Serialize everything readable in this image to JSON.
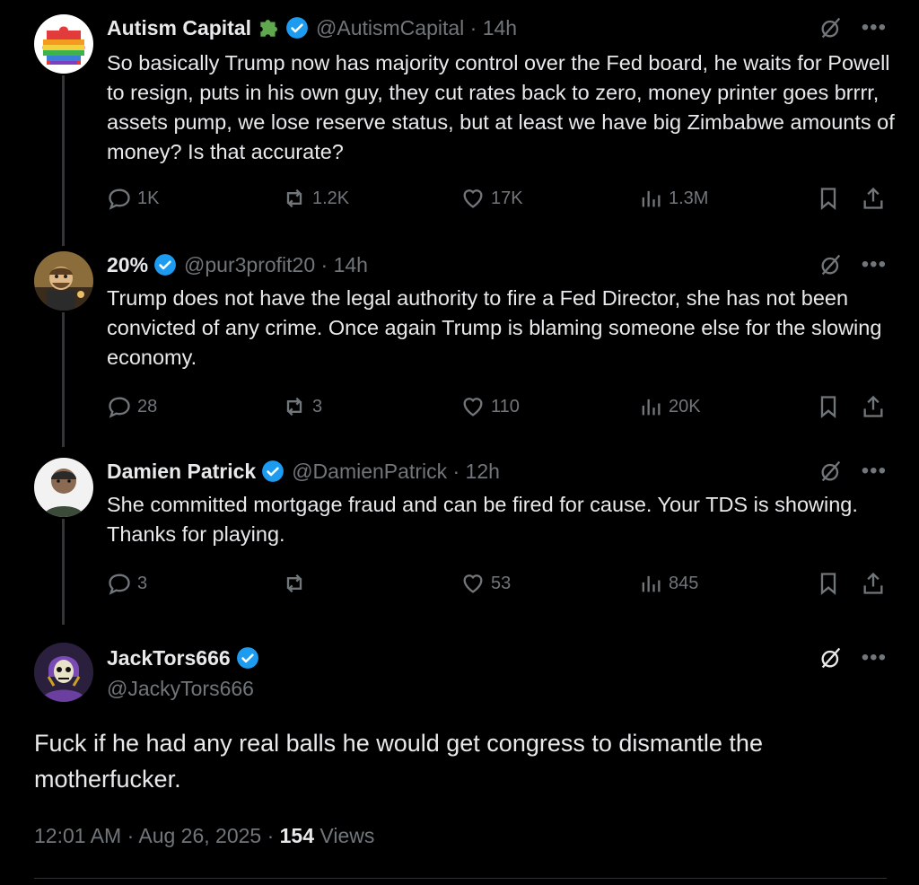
{
  "tweets": [
    {
      "name": "Autism Capital",
      "handle": "@AutismCapital · 14h",
      "text": "So basically Trump now has majority control over the Fed board, he waits for Powell to resign, puts in his own guy, they cut rates back to zero, money printer goes brrrr, assets pump, we lose reserve status, but at least we have big Zimbabwe amounts of money? Is that accurate?",
      "replies": "1K",
      "reposts": "1.2K",
      "likes": "17K",
      "views": "1.3M"
    },
    {
      "name": "20%",
      "handle": "@pur3profit20 · 14h",
      "text": "Trump does not have the legal authority to fire a Fed Director, she has not been convicted of any crime. Once again Trump is blaming someone else for the slowing economy.",
      "replies": "28",
      "reposts": "3",
      "likes": "110",
      "views": "20K"
    },
    {
      "name": "Damien Patrick",
      "handle": "@DamienPatrick · 12h",
      "text": "She committed mortgage fraud and can be fired for cause. Your TDS is showing.  Thanks for playing.",
      "replies": "3",
      "reposts": "",
      "likes": "53",
      "views": "845"
    }
  ],
  "main": {
    "name": "JackTors666",
    "handle": "@JackyTors666",
    "text": "Fuck if he had any real balls he would get congress to dismantle the motherfucker.",
    "time": "12:01 AM · Aug 26, 2025 · ",
    "views_count": "154",
    "views_label": " Views"
  },
  "icons": {
    "reply": "reply-icon",
    "repost": "repost-icon",
    "like": "heart-icon",
    "views": "views-icon",
    "bookmark": "bookmark-icon",
    "share": "share-icon",
    "grok": "grok-icon",
    "more": "more-icon",
    "verified": "verified-badge-icon"
  },
  "colors": {
    "background": "#000000",
    "text": "#e7e9ea",
    "secondary": "#71767b",
    "verified": "#1d9bf0"
  }
}
